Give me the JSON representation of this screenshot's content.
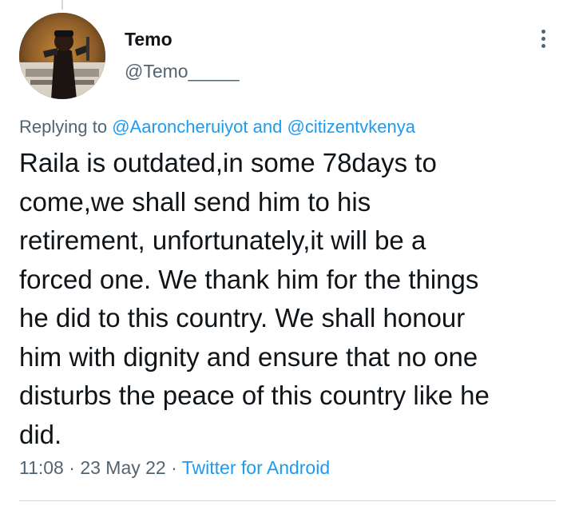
{
  "user": {
    "display_name": "Temo",
    "handle": "@Temo_____"
  },
  "reply": {
    "prefix": "Replying to",
    "mention_1": "@Aaroncheruiyot",
    "conjunction": "and",
    "mention_2": "@citizentvkenya"
  },
  "tweet": {
    "text": "Raila is outdated,in some 78days to\ncome,we shall send him to his\nretirement, unfortunately,it will be a\nforced one. We thank him for the things\nhe did to this country. We shall honour\nhim with dignity and ensure that no one\ndisturbs the peace of this country like he\ndid."
  },
  "meta": {
    "time": "11:08",
    "separator": "·",
    "date": "23 May 22",
    "source": "Twitter for Android"
  },
  "icons": {
    "more": "more-vertical-icon"
  },
  "colors": {
    "link": "#1d9bf0",
    "secondary_text": "#536471",
    "primary_text": "#0f1419"
  }
}
